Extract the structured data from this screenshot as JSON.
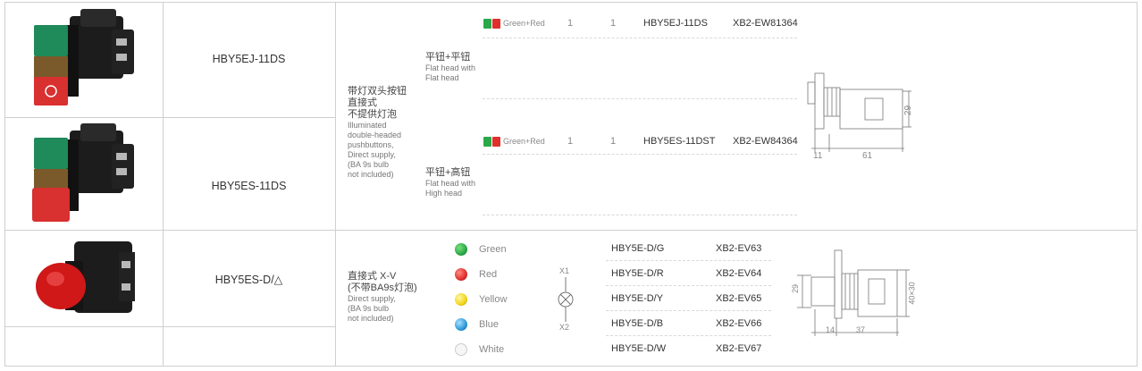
{
  "rows": [
    {
      "model": "HBY5EJ-11DS",
      "variants": [
        {
          "type_cn": "平钮+平钮",
          "type_en_1": "Flat head with",
          "type_en_2": "Flat head",
          "color_label": "Green+Red",
          "qty1": "1",
          "qty2": "1",
          "part": "HBY5EJ-11DS",
          "ref": "XB2-EW81364"
        }
      ]
    },
    {
      "model": "HBY5ES-11DS",
      "variants": [
        {
          "type_cn": "平钮+高钮",
          "type_en_1": "Flat head with",
          "type_en_2": "High head",
          "color_label": "Green+Red",
          "qty1": "1",
          "qty2": "1",
          "part": "HBY5ES-11DST",
          "ref": "XB2-EW84364"
        }
      ]
    },
    {
      "model": "HBY5ES-D/△"
    }
  ],
  "group1_desc": {
    "cn_1": "带灯双头按钮",
    "cn_2": "直接式",
    "cn_3": "不提供灯泡",
    "en_1": "Illuminated",
    "en_2": "double-headed",
    "en_3": "pushbuttons,",
    "en_4": "Direct supply,",
    "en_5": "(BA 9s bulb",
    "en_6": "not included)"
  },
  "group1_dims": {
    "d1": "29",
    "d2": "11",
    "d3": "61"
  },
  "group2_desc": {
    "cn_1": "直接式 X-V",
    "cn_2": "(不带BA9s灯泡)",
    "en_1": "Direct supply,",
    "en_2": "(BA 9s bulb",
    "en_3": "not included)"
  },
  "group2_symbol": {
    "top": "X1",
    "bottom": "X2"
  },
  "group2_items": [
    {
      "color_name": "Green",
      "color_hex": "#2aa84a",
      "part": "HBY5E-D/G",
      "ref": "XB2-EV63"
    },
    {
      "color_name": "Red",
      "color_hex": "#e0302c",
      "part": "HBY5E-D/R",
      "ref": "XB2-EV64"
    },
    {
      "color_name": "Yellow",
      "color_hex": "#f2d51c",
      "part": "HBY5E-D/Y",
      "ref": "XB2-EV65"
    },
    {
      "color_name": "Blue",
      "color_hex": "#2e9ad8",
      "part": "HBY5E-D/B",
      "ref": "XB2-EV66"
    },
    {
      "color_name": "White",
      "color_hex": "#f4f4f4",
      "part": "HBY5E-D/W",
      "ref": "XB2-EV67"
    }
  ],
  "group2_dims": {
    "d1": "29",
    "d2": "40×30",
    "d3": "14",
    "d4": "37"
  }
}
